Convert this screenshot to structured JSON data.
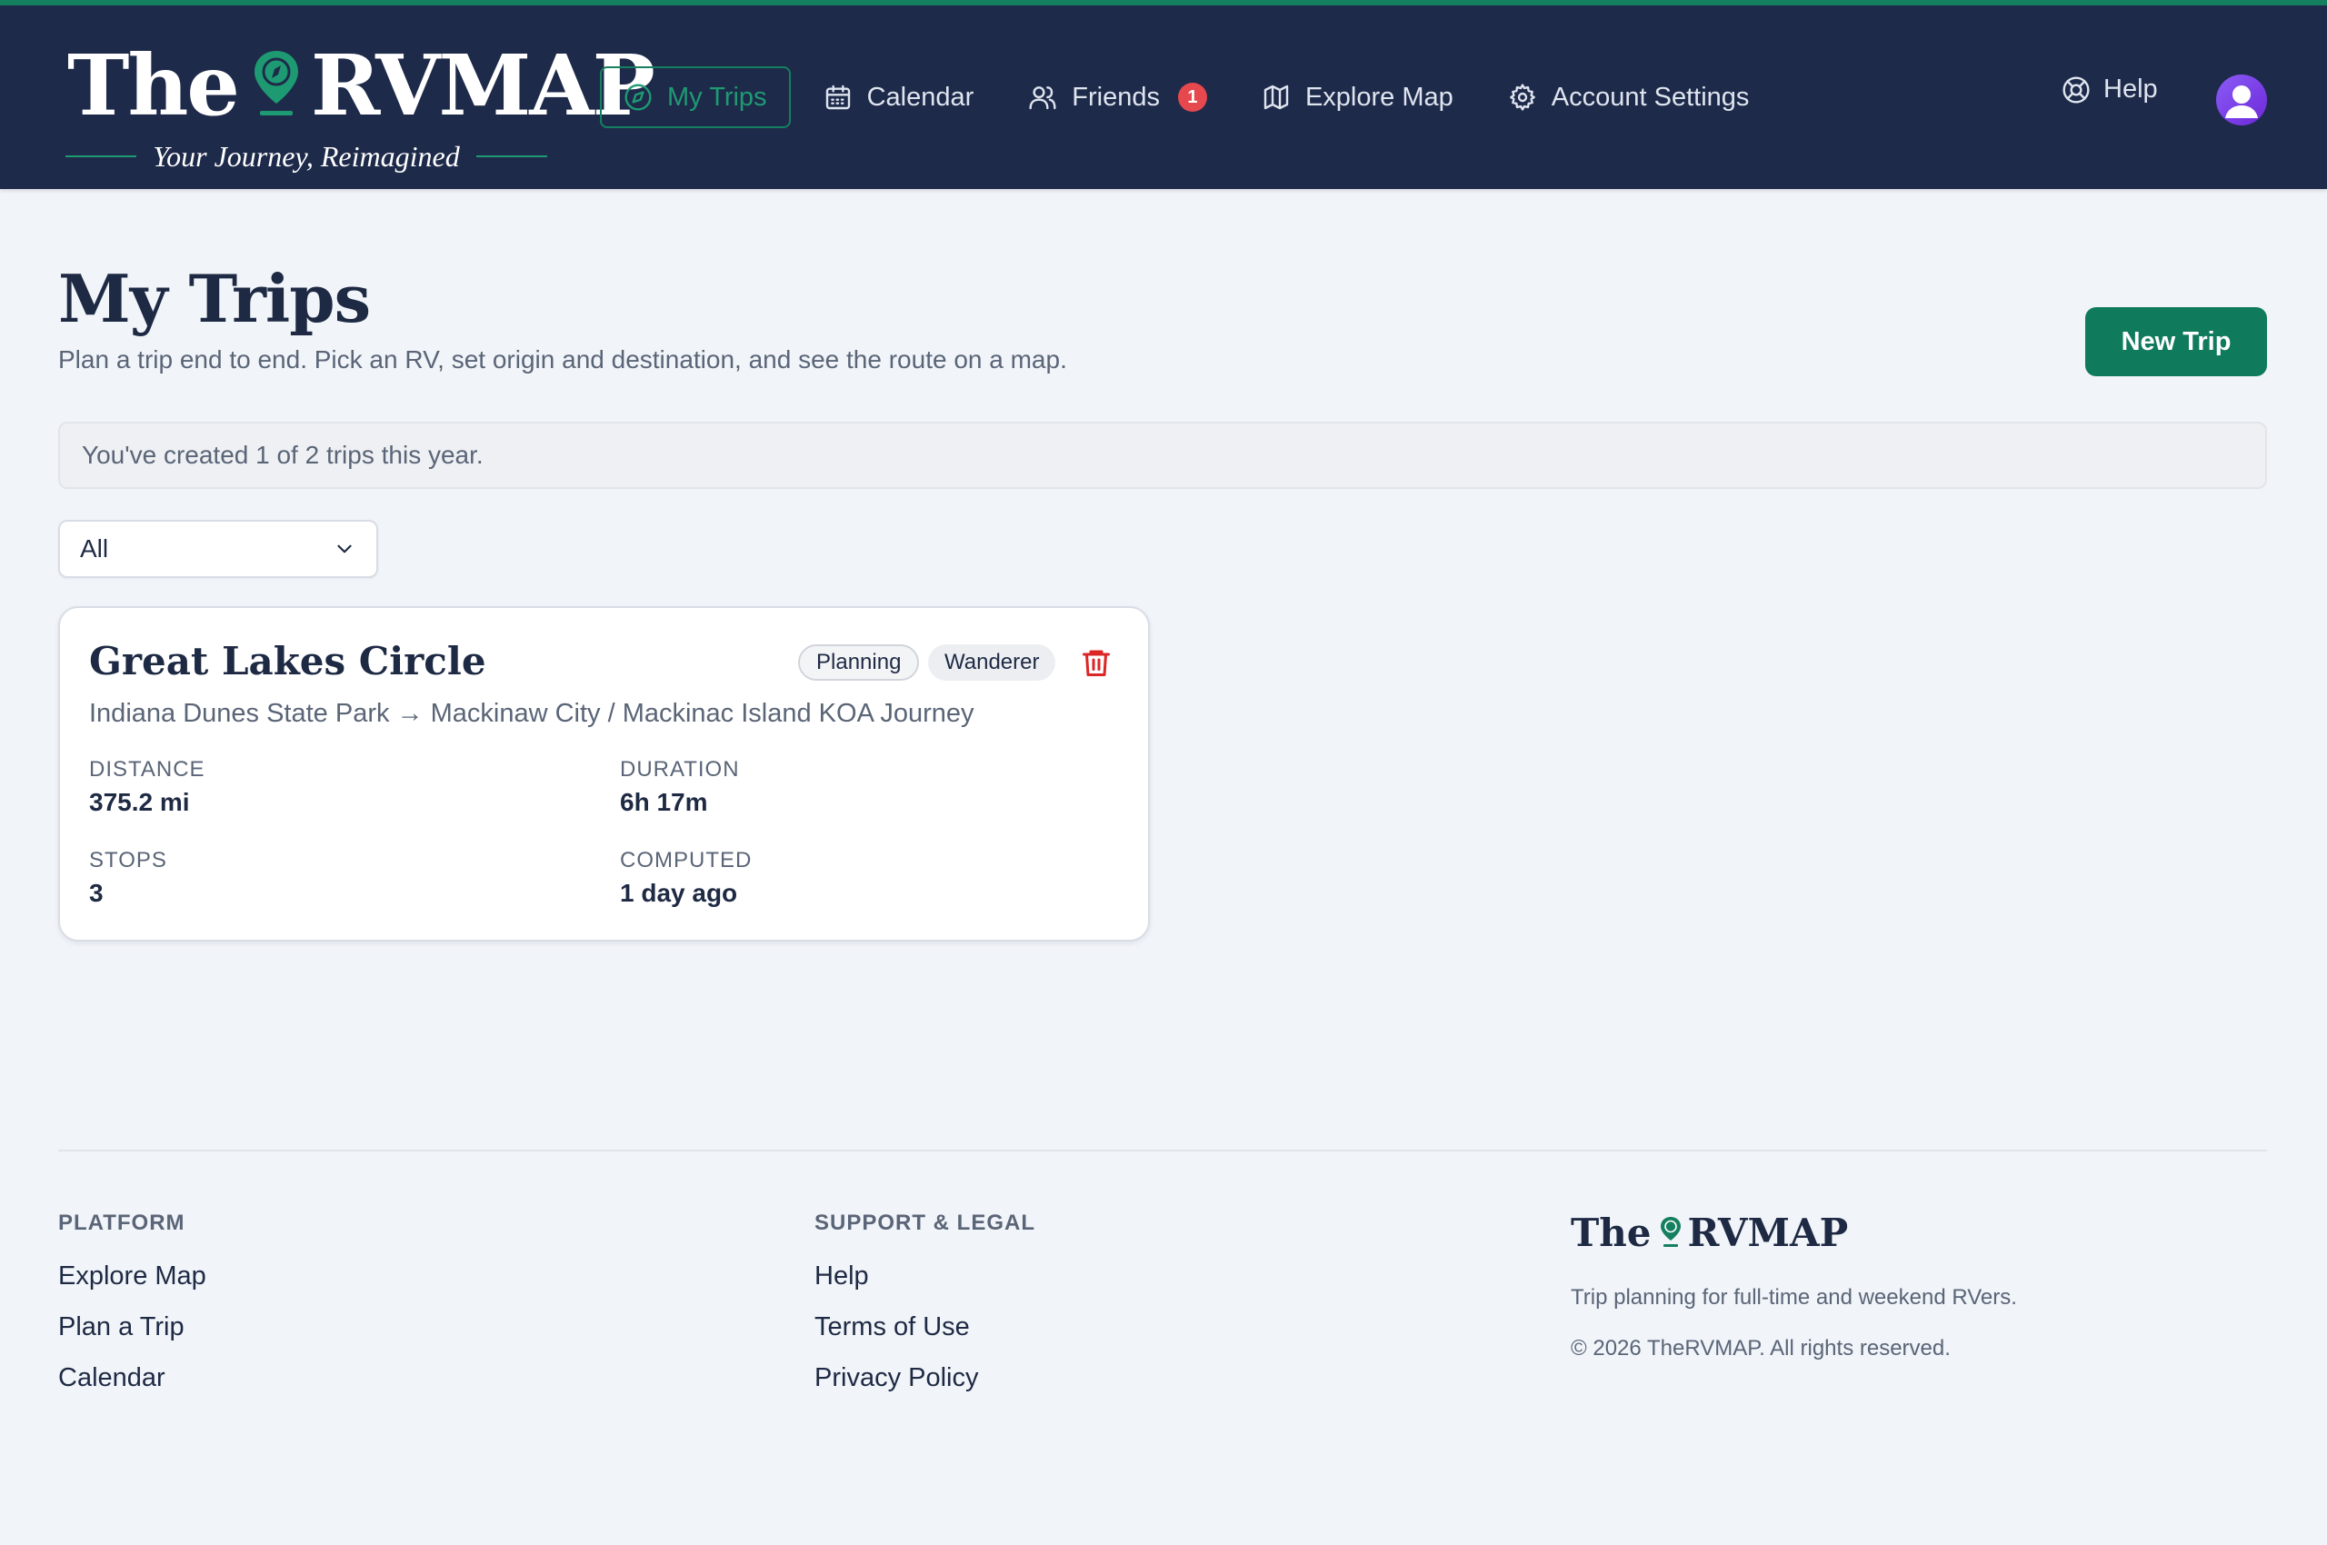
{
  "brand": {
    "the": "The",
    "rvmap": "RVMAP",
    "tagline": "Your Journey, Reimagined",
    "accent_color": "#15805f",
    "header_bg": "#1e2a4a"
  },
  "nav": {
    "items": [
      {
        "label": "My Trips",
        "icon": "compass-icon",
        "active": true
      },
      {
        "label": "Calendar",
        "icon": "calendar-icon"
      },
      {
        "label": "Friends",
        "icon": "users-icon",
        "badge": "1"
      },
      {
        "label": "Explore Map",
        "icon": "map-icon"
      },
      {
        "label": "Account Settings",
        "icon": "gear-icon"
      }
    ],
    "help_label": "Help"
  },
  "page": {
    "title": "My Trips",
    "subtitle": "Plan a trip end to end. Pick an RV, set origin and destination, and see the route on a map.",
    "new_trip_label": "New Trip",
    "quota_text": "You've created 1 of 2 trips this year.",
    "filter_value": "All"
  },
  "trips": [
    {
      "name": "Great Lakes Circle",
      "status": "Planning",
      "rv": "Wanderer",
      "route": "Indiana Dunes State Park → Mackinaw City / Mackinac Island KOA Journey",
      "distance_label": "DISTANCE",
      "distance": "375.2 mi",
      "duration_label": "DURATION",
      "duration": "6h 17m",
      "stops_label": "STOPS",
      "stops": "3",
      "computed_label": "COMPUTED",
      "computed": "1 day ago"
    }
  ],
  "footer": {
    "platform_heading": "PLATFORM",
    "platform_links": [
      "Explore Map",
      "Plan a Trip",
      "Calendar"
    ],
    "support_heading": "SUPPORT & LEGAL",
    "support_links": [
      "Help",
      "Terms of Use",
      "Privacy Policy"
    ],
    "description": "Trip planning for full-time and weekend RVers.",
    "copyright": "© 2026 TheRVMAP. All rights reserved."
  }
}
